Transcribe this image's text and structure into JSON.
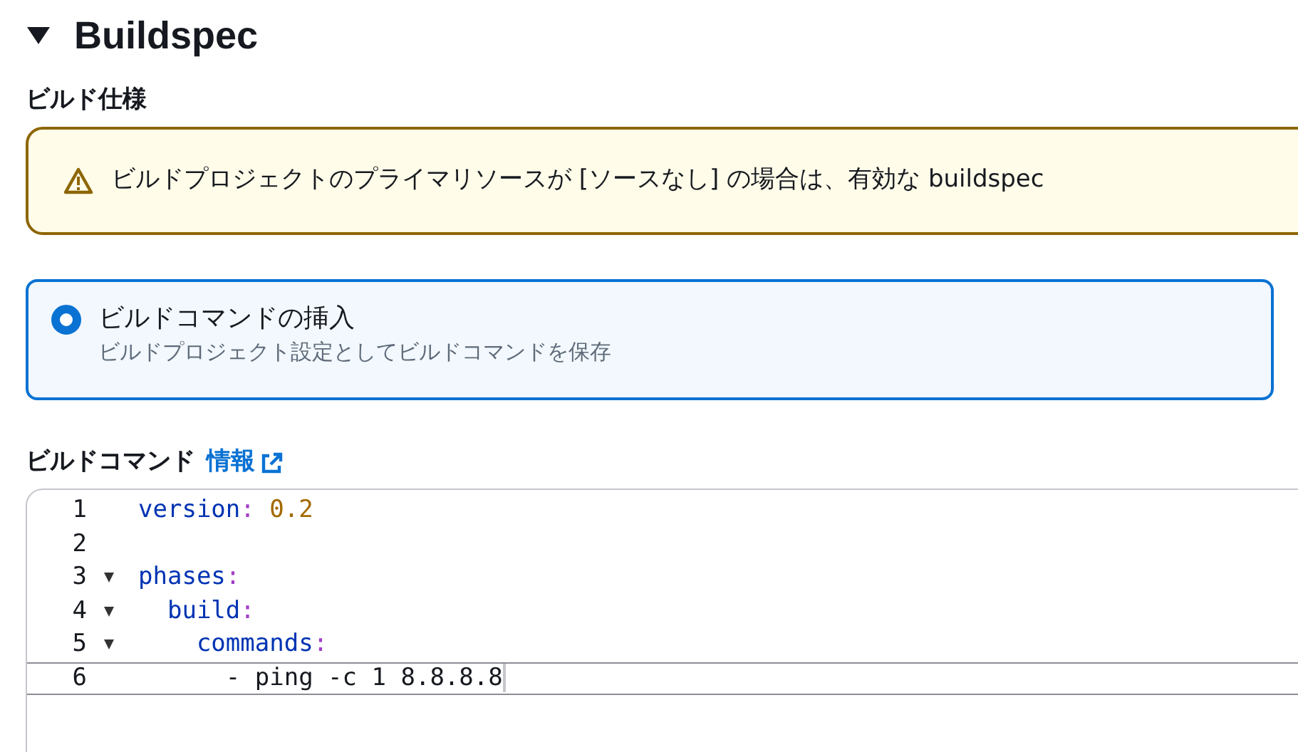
{
  "section": {
    "title": "Buildspec",
    "expanded": true
  },
  "spec_label": "ビルド仕様",
  "alert": {
    "kind": "warning",
    "text": "ビルドプロジェクトのプライマリソースが [ソースなし] の場合は、有効な buildspec"
  },
  "options": [
    {
      "label": "ビルドコマンドの挿入",
      "description": "ビルドプロジェクト設定としてビルドコマンドを保存",
      "selected": true
    }
  ],
  "commands_label": "ビルドコマンド",
  "info_link": "情報",
  "editor": {
    "lines": [
      {
        "number": "1",
        "foldable": false,
        "active": false,
        "tokens": [
          {
            "text": "version",
            "kind": "key"
          },
          {
            "text": ":",
            "kind": "punct"
          },
          {
            "text": " 0.2",
            "kind": "number"
          }
        ]
      },
      {
        "number": "2",
        "foldable": false,
        "active": false
      },
      {
        "number": "3",
        "foldable": true,
        "active": false,
        "tokens": [
          {
            "text": "phases",
            "kind": "key"
          },
          {
            "text": ":",
            "kind": "punct"
          }
        ]
      },
      {
        "number": "4",
        "foldable": true,
        "active": false,
        "tokens": [
          {
            "text": "  build",
            "kind": "key"
          },
          {
            "text": ":",
            "kind": "punct"
          }
        ]
      },
      {
        "number": "5",
        "foldable": true,
        "active": false,
        "tokens": [
          {
            "text": "    commands",
            "kind": "key"
          },
          {
            "text": ":",
            "kind": "punct"
          }
        ]
      },
      {
        "number": "6",
        "foldable": false,
        "active": true,
        "tokens": [
          {
            "text": "      - ping -c 1 8.8.8.8",
            "kind": "plain"
          }
        ]
      }
    ]
  }
}
